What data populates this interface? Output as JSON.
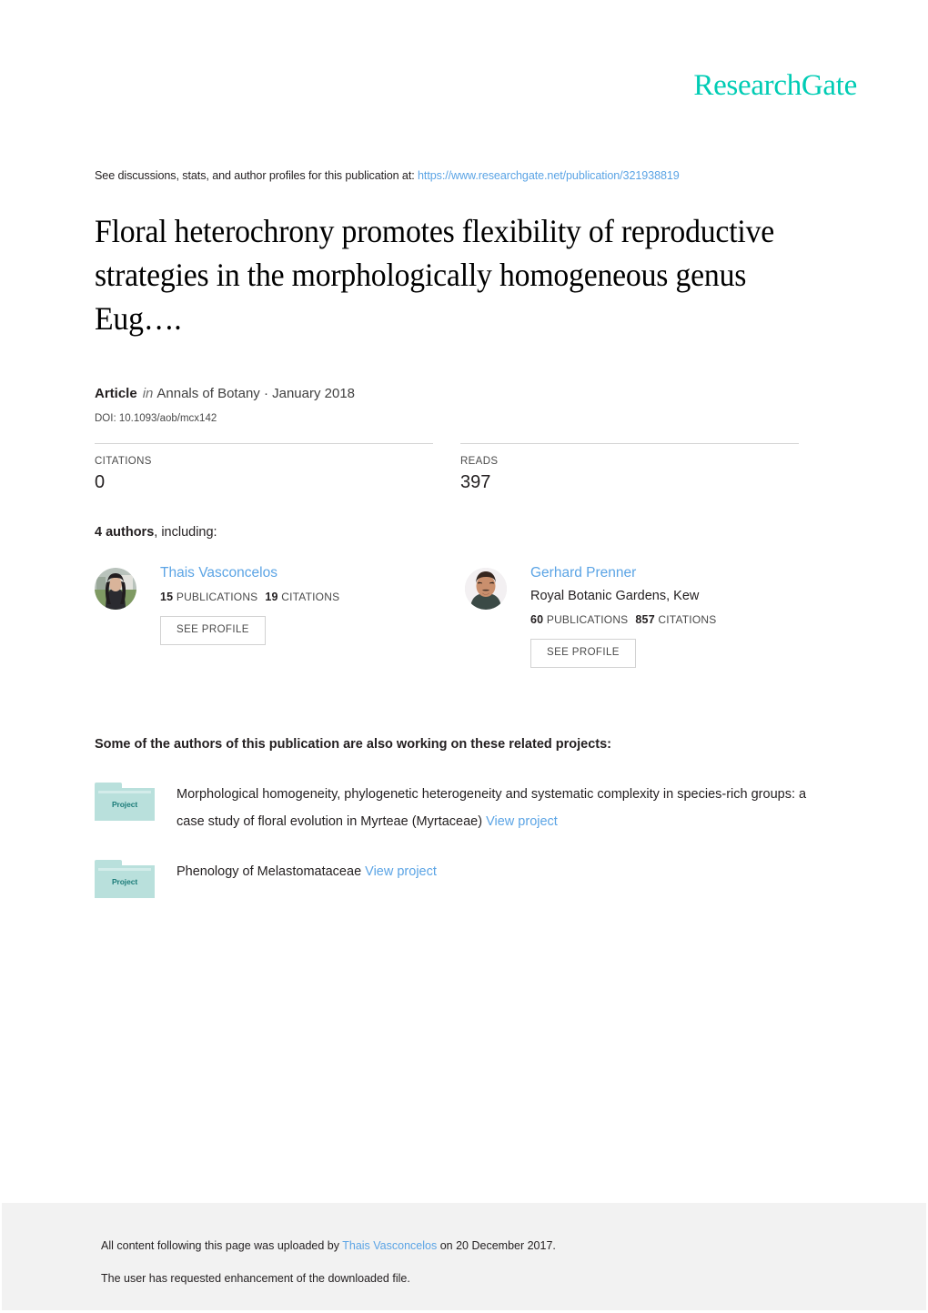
{
  "brand": {
    "logo_text": "ResearchGate",
    "logo_color": "#00ccb4",
    "link_color": "#5ba4e5"
  },
  "header": {
    "discussion_prefix": "See discussions, stats, and author profiles for this publication at:",
    "publication_url": "https://www.researchgate.net/publication/321938819"
  },
  "publication": {
    "title": "Floral heterochrony promotes flexibility of reproductive strategies in the morphologically homogeneous genus Eug….",
    "type_label": "Article",
    "in_word": "in",
    "venue_and_date": "Annals of Botany · January 2018",
    "doi": "DOI: 10.1093/aob/mcx142"
  },
  "stats": [
    {
      "label": "CITATIONS",
      "value": "0"
    },
    {
      "label": "READS",
      "value": "397"
    }
  ],
  "authors_section": {
    "count_text": "4 authors",
    "suffix_text": ", including:",
    "see_profile_label": "SEE PROFILE",
    "authors": [
      {
        "name": "Thais Vasconcelos",
        "institution": "",
        "publications_count": "15",
        "publications_label": "PUBLICATIONS",
        "citations_count": "19",
        "citations_label": "CITATIONS",
        "avatar": "photo-woman-outdoors"
      },
      {
        "name": "Gerhard Prenner",
        "institution": "Royal Botanic Gardens, Kew",
        "publications_count": "60",
        "publications_label": "PUBLICATIONS",
        "citations_count": "857",
        "citations_label": "CITATIONS",
        "avatar": "photo-man-portrait"
      }
    ]
  },
  "projects_section": {
    "heading": "Some of the authors of this publication are also working on these related projects:",
    "folder_label": "Project",
    "view_project_label": "View project",
    "projects": [
      {
        "description": "Morphological homogeneity, phylogenetic heterogeneity and systematic complexity in species-rich groups: a case study of floral evolution in Myrteae (Myrtaceae)"
      },
      {
        "description": "Phenology of Melastomataceae"
      }
    ]
  },
  "footer": {
    "upload_prefix": "All content following this page was uploaded by",
    "uploader": "Thais Vasconcelos",
    "upload_suffix": "on 20 December 2017.",
    "enhancement_note": "The user has requested enhancement of the downloaded file."
  }
}
